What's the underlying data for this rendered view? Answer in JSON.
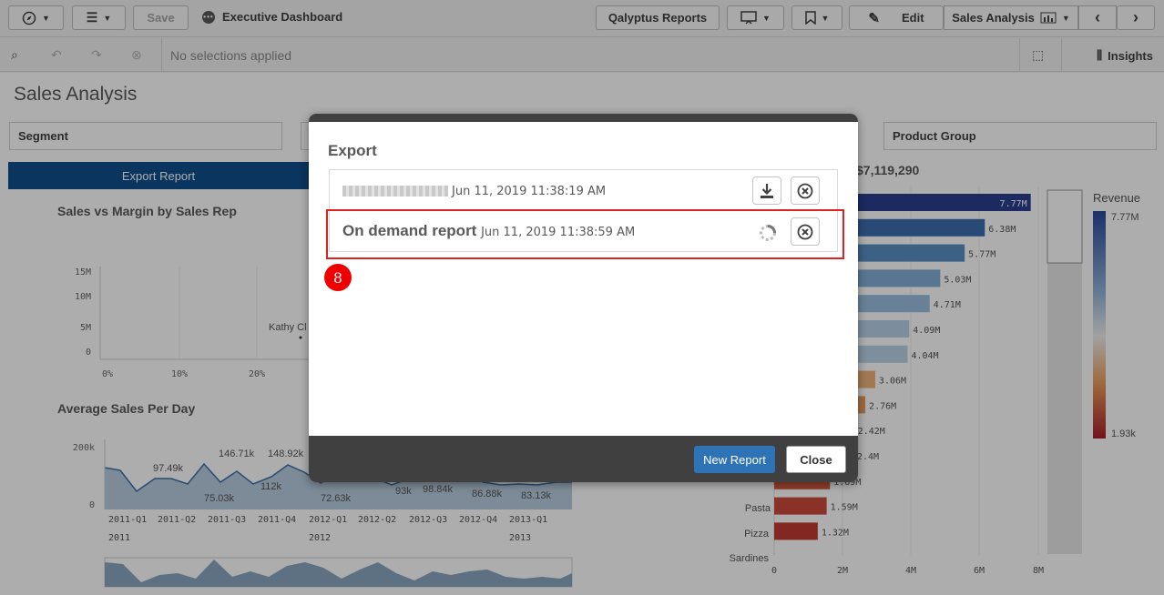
{
  "toolbar": {
    "save_label": "Save",
    "app_title": "Executive Dashboard",
    "qalyptus_label": "Qalyptus Reports",
    "edit_label": "Edit",
    "sheet_label": "Sales Analysis"
  },
  "selections": {
    "status": "No selections applied",
    "insights_label": "Insights"
  },
  "sheet": {
    "title": "Sales Analysis",
    "filters": [
      "Segment",
      "Product Group"
    ],
    "export_button": "Export Report",
    "total": "$7,119,290",
    "chart_titles": {
      "scatter": "Sales vs Margin by Sales Rep",
      "line": "Average Sales Per Day"
    },
    "scatter": {
      "y_ticks": [
        "15M",
        "10M",
        "5M",
        "0"
      ],
      "x_ticks": [
        "0%",
        "10%",
        "20%"
      ],
      "point_label": "Kathy Cl"
    },
    "line": {
      "y_ticks": [
        "200k",
        "0"
      ],
      "value_labels": [
        "97.49k",
        "146.71k",
        "148.92k",
        "75.03k",
        "112k",
        "72.63k",
        "93k",
        "98.84k",
        "86.88k",
        "83.13k"
      ],
      "quarters": [
        "2011-Q1",
        "2011-Q2",
        "2011-Q3",
        "2011-Q4",
        "2012-Q1",
        "2012-Q2",
        "2012-Q3",
        "2012-Q4",
        "2013-Q1"
      ],
      "years": [
        "2011",
        "2012",
        "2013"
      ]
    },
    "bars": {
      "values": [
        "7.77M",
        "6.38M",
        "5.77M",
        "5.03M",
        "4.71M",
        "4.09M",
        "4.04M",
        "3.06M",
        "2.76M",
        "2.42M",
        "2.4M",
        "1.69M",
        "1.59M",
        "1.32M"
      ],
      "categories_visible": [
        "Pasta",
        "Pizza",
        "Sardines"
      ],
      "x_ticks": [
        "0",
        "2M",
        "4M",
        "6M",
        "8M"
      ],
      "legend_title": "Revenue",
      "legend_max": "7.77M",
      "legend_min": "1.93k"
    }
  },
  "modal": {
    "title": "Export",
    "reports": [
      {
        "name": "",
        "date": "Jun 11, 2019 11:38:19 AM",
        "status": "ready"
      },
      {
        "name": "On demand report",
        "date": "Jun 11, 2019 11:38:59 AM",
        "status": "loading"
      }
    ],
    "step_badge": "8",
    "new_report_label": "New Report",
    "close_label": "Close"
  },
  "colors": {
    "accent": "#1f6fbf",
    "highlight": "#dd2222",
    "footer": "#404040"
  }
}
